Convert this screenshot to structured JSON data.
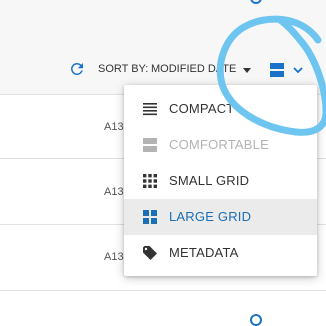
{
  "toolbar": {
    "sort_by_label": "SORT BY:",
    "sort_value": "MODIFIED DATE",
    "refresh_icon": "refresh-icon",
    "view_icon": "large-grid-icon",
    "accent_color": "#1a73c8"
  },
  "rows": [
    {
      "code": "A13"
    },
    {
      "code": "A13"
    },
    {
      "code": "A13"
    }
  ],
  "view_menu": {
    "items": [
      {
        "label": "COMPACT",
        "icon": "list-compact-icon",
        "state": "normal"
      },
      {
        "label": "COMFORTABLE",
        "icon": "list-comfortable-icon",
        "state": "disabled"
      },
      {
        "label": "SMALL GRID",
        "icon": "small-grid-icon",
        "state": "normal"
      },
      {
        "label": "LARGE GRID",
        "icon": "large-grid-icon",
        "state": "selected"
      },
      {
        "label": "METADATA",
        "icon": "tag-icon",
        "state": "normal"
      }
    ],
    "selected_color": "#1a6fb5",
    "disabled_color": "#b3b3b3"
  },
  "annotation": {
    "type": "hand-drawn circle",
    "color": "#6ec6f0"
  }
}
